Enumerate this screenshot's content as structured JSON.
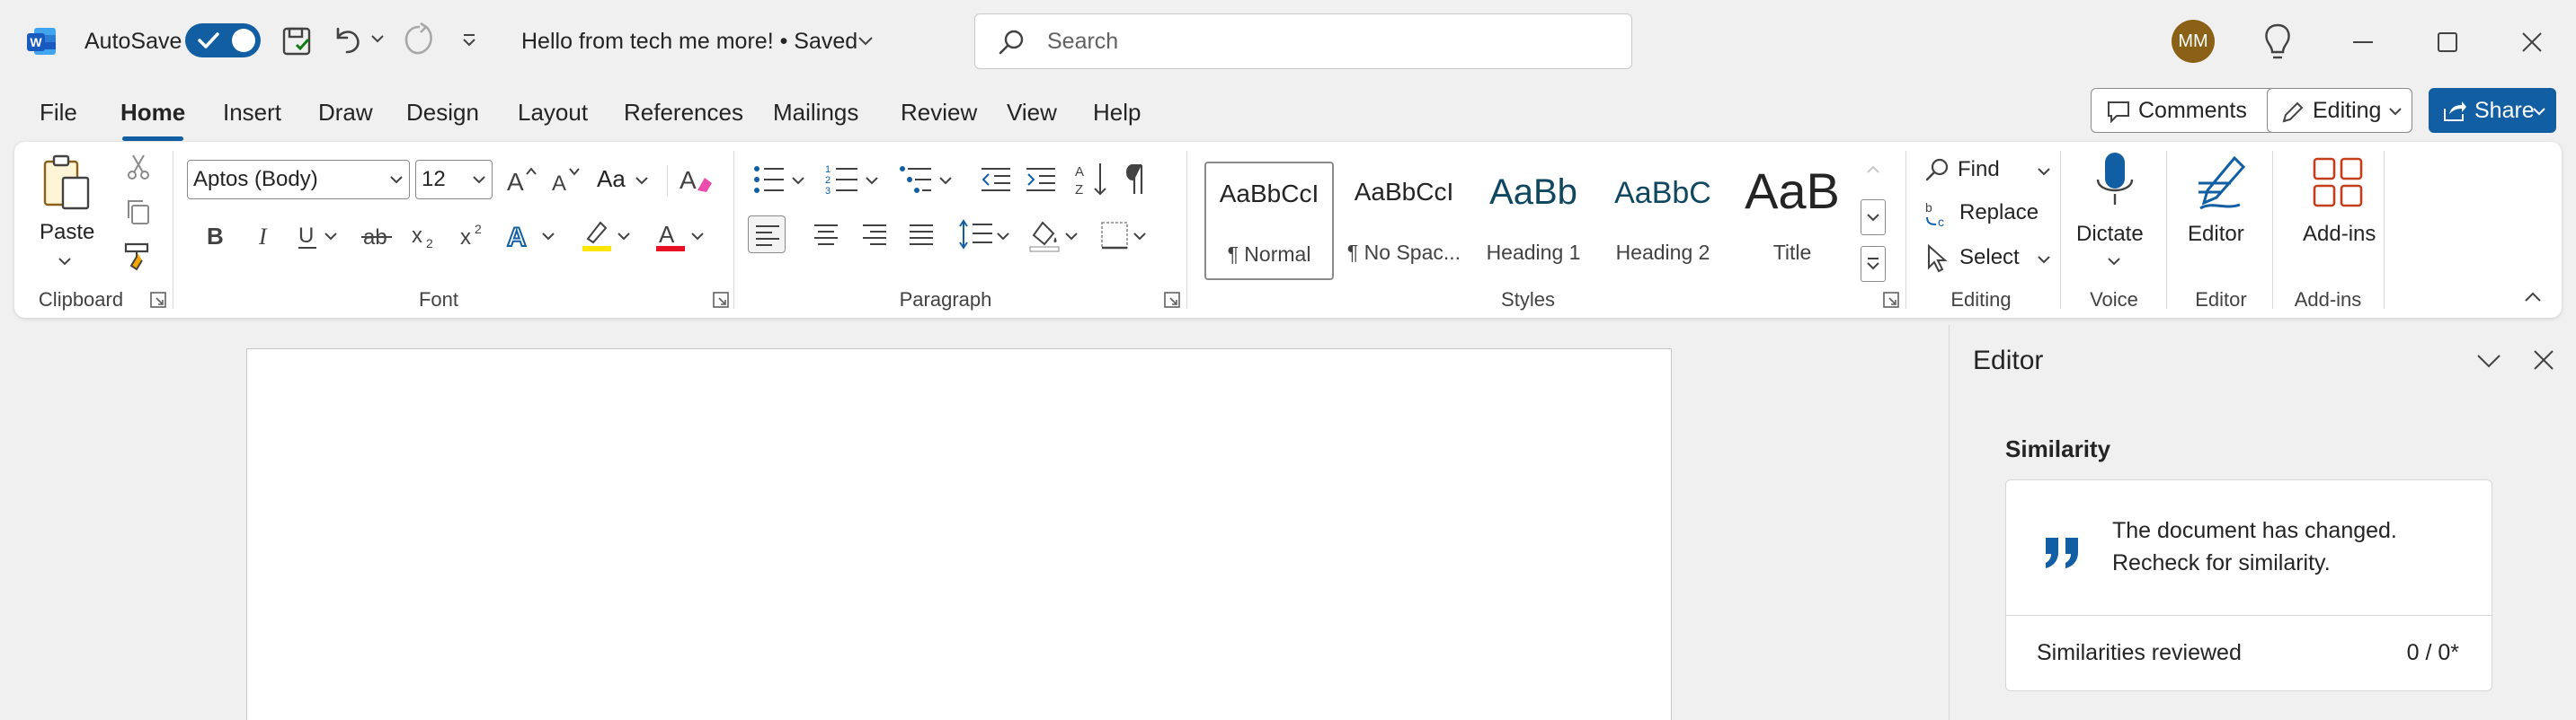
{
  "titlebar": {
    "autosave_label": "AutoSave",
    "autosave_on": true,
    "doc_title": "Hello from tech me more!  •  Saved",
    "search_placeholder": "Search",
    "avatar_initials": "MM"
  },
  "menu": {
    "tabs": [
      {
        "label": "File"
      },
      {
        "label": "Home",
        "active": true
      },
      {
        "label": "Insert"
      },
      {
        "label": "Draw"
      },
      {
        "label": "Design"
      },
      {
        "label": "Layout"
      },
      {
        "label": "References"
      },
      {
        "label": "Mailings"
      },
      {
        "label": "Review"
      },
      {
        "label": "View"
      },
      {
        "label": "Help"
      }
    ],
    "comments_label": "Comments",
    "editing_label": "Editing",
    "share_label": "Share"
  },
  "ribbon": {
    "clipboard": {
      "label": "Clipboard",
      "paste_label": "Paste"
    },
    "font": {
      "label": "Font",
      "font_name": "Aptos (Body)",
      "font_size": "12",
      "case_label": "Aa"
    },
    "paragraph": {
      "label": "Paragraph"
    },
    "styles": {
      "label": "Styles",
      "items": [
        {
          "sample": "AaBbCcI",
          "name": "¶ Normal"
        },
        {
          "sample": "AaBbCcI",
          "name": "¶ No Spac..."
        },
        {
          "sample": "AaBb",
          "name": "Heading 1"
        },
        {
          "sample": "AaBbC",
          "name": "Heading 2"
        },
        {
          "sample": "AaB",
          "name": "Title"
        }
      ]
    },
    "editing": {
      "label": "Editing",
      "find_label": "Find",
      "replace_label": "Replace",
      "select_label": "Select"
    },
    "voice": {
      "label": "Voice",
      "dictate_label": "Dictate"
    },
    "editor": {
      "label": "Editor",
      "button_label": "Editor"
    },
    "addins": {
      "label": "Add-ins",
      "button_label": "Add-ins"
    }
  },
  "editor_pane": {
    "title": "Editor",
    "section": "Similarity",
    "message_line1": "The document has changed.",
    "message_line2": "Recheck for similarity.",
    "reviewed_label": "Similarities reviewed",
    "reviewed_value": "0 / 0*"
  },
  "colors": {
    "accent": "#115ea3",
    "font_color": "#e81123",
    "highlight": "#ffe600",
    "avatar": "#8a6116"
  }
}
